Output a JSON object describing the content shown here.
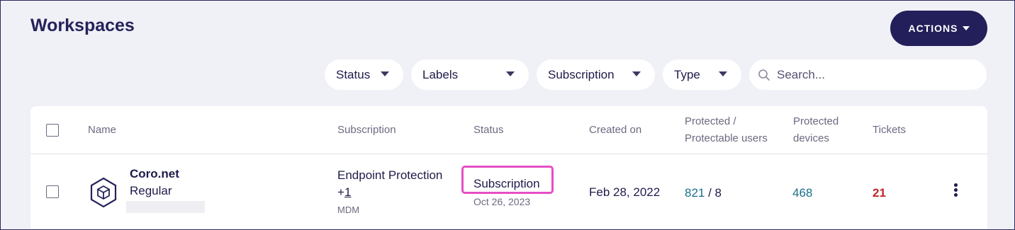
{
  "page": {
    "title": "Workspaces"
  },
  "toolbar": {
    "actions_label": "ACTIONS"
  },
  "filters": {
    "status": "Status",
    "labels": "Labels",
    "subscription": "Subscription",
    "type": "Type"
  },
  "search": {
    "placeholder": "Search..."
  },
  "table": {
    "headers": {
      "name": "Name",
      "subscription": "Subscription",
      "status": "Status",
      "created_on": "Created on",
      "protected_users_line1": "Protected /",
      "protected_users_line2": "Protectable users",
      "protected_devices_line1": "Protected",
      "protected_devices_line2": "devices",
      "tickets": "Tickets"
    },
    "rows": [
      {
        "name": "Coro.net",
        "type": "Regular",
        "subscription_main": "Endpoint Protection",
        "subscription_more_prefix": "+",
        "subscription_more_count": "1",
        "subscription_addon": "MDM",
        "status": "Subscription",
        "status_date": "Oct 26, 2023",
        "created_on": "Feb 28, 2022",
        "protected_users": "821",
        "users_separator": " / ",
        "protectable_users": "8",
        "protected_devices": "468",
        "tickets": "21"
      }
    ]
  },
  "colors": {
    "accent": "#221f5a",
    "highlight": "#e54fc6",
    "link": "#1a6f8a",
    "tickets": "#c0272d"
  }
}
